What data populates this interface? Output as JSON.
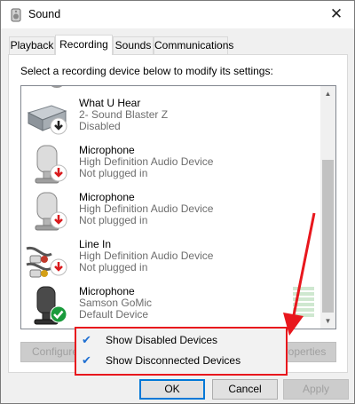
{
  "window": {
    "title": "Sound",
    "close_glyph": "✕"
  },
  "tabs": [
    {
      "label": "Playback",
      "active": false
    },
    {
      "label": "Recording",
      "active": true
    },
    {
      "label": "Sounds",
      "active": false
    },
    {
      "label": "Communications",
      "active": false
    }
  ],
  "instructions": "Select a recording device below to modify its settings:",
  "devices": [
    {
      "name": "What U Hear",
      "line2": "2- Sound Blaster Z",
      "line3": "Disabled",
      "icon": "soundcard-icon",
      "status": "disabled"
    },
    {
      "name": "Microphone",
      "line2": "High Definition Audio Device",
      "line3": "Not plugged in",
      "icon": "microphone-icon",
      "status": "unplugged"
    },
    {
      "name": "Microphone",
      "line2": "High Definition Audio Device",
      "line3": "Not plugged in",
      "icon": "microphone-icon",
      "status": "unplugged"
    },
    {
      "name": "Line In",
      "line2": "High Definition Audio Device",
      "line3": "Not plugged in",
      "icon": "line-in-icon",
      "status": "unplugged"
    },
    {
      "name": "Microphone",
      "line2": "Samson GoMic",
      "line3": "Default Device",
      "icon": "microphone-icon",
      "status": "default"
    }
  ],
  "buttons": {
    "configure": "Configure",
    "properties": "Properties",
    "ok": "OK",
    "cancel": "Cancel",
    "apply": "Apply"
  },
  "context_menu": {
    "items": [
      {
        "label": "Show Disabled Devices",
        "checked": true
      },
      {
        "label": "Show Disconnected Devices",
        "checked": true
      }
    ]
  },
  "colors": {
    "highlight": "#e8171d",
    "status_unplugged": "#d9191c",
    "status_default": "#1a9b3c",
    "status_disabled": "#222222",
    "check": "#1f6fd1"
  }
}
